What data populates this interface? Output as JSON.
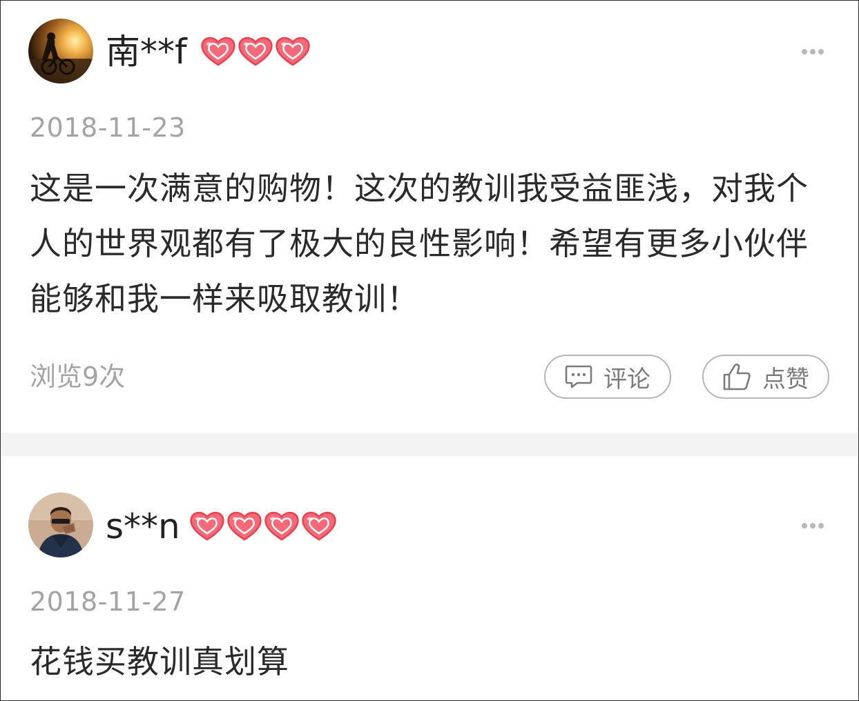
{
  "comments": [
    {
      "username": "南**f",
      "heart_count": 3,
      "date": "2018-11-23",
      "content": "这是一次满意的购物！这次的教训我受益匪浅，对我个人的世界观都有了极大的良性影响！希望有更多小伙伴能够和我一样来吸取教训！",
      "views": "浏览9次",
      "comment_label": "评论",
      "like_label": "点赞"
    },
    {
      "username": "s**n",
      "heart_count": 4,
      "date": "2018-11-27",
      "content": "花钱买教训真划算"
    }
  ],
  "colors": {
    "heart_fill": "#f46a78",
    "heart_stroke": "#e8424f",
    "separator": "#f3f3f3",
    "meta_text": "#a3a3a3"
  },
  "icons": {
    "more": "more-dots-icon",
    "comment": "comment-bubble-icon",
    "like": "thumbs-up-icon",
    "level": "heart-level-icon"
  }
}
